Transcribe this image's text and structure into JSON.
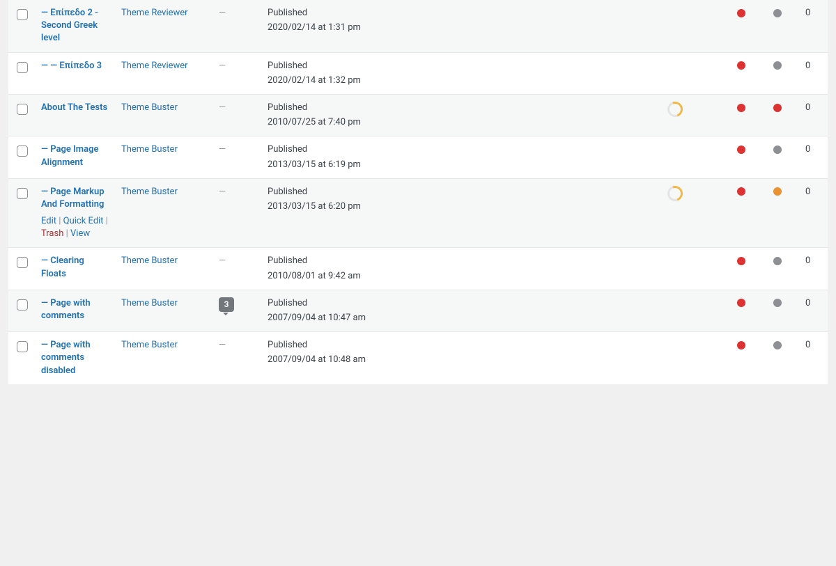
{
  "row_count": 8,
  "row_actions": {
    "edit": "Edit",
    "quick_edit": "Quick Edit",
    "trash": "Trash",
    "view": "View",
    "sep": " | "
  },
  "rows": [
    {
      "alt": true,
      "title": "— Επίπεδο 2 - Second Greek level",
      "author": "Theme Reviewer",
      "comments_dash": "—",
      "status": "Published",
      "datetime": "2020/02/14 at 1:31 pm",
      "readability_ring": false,
      "dot1": "red",
      "dot2": "grey",
      "links": "0",
      "show_actions": false
    },
    {
      "alt": false,
      "title": "— — Επίπεδο 3",
      "author": "Theme Reviewer",
      "comments_dash": "—",
      "status": "Published",
      "datetime": "2020/02/14 at 1:32 pm",
      "readability_ring": false,
      "dot1": "red",
      "dot2": "grey",
      "links": "0",
      "show_actions": false
    },
    {
      "alt": true,
      "title": "About The Tests",
      "author": "Theme Buster",
      "comments_dash": "—",
      "status": "Published",
      "datetime": "2010/07/25 at 7:40 pm",
      "readability_ring": true,
      "dot1": "red",
      "dot2": "red",
      "links": "0",
      "show_actions": false
    },
    {
      "alt": false,
      "title": "— Page Image Alignment",
      "author": "Theme Buster",
      "comments_dash": "—",
      "status": "Published",
      "datetime": "2013/03/15 at 6:19 pm",
      "readability_ring": false,
      "dot1": "red",
      "dot2": "grey",
      "links": "0",
      "show_actions": false
    },
    {
      "alt": true,
      "title": "— Page Markup And Formatting",
      "author": "Theme Buster",
      "comments_dash": "—",
      "status": "Published",
      "datetime": "2013/03/15 at 6:20 pm",
      "readability_ring": true,
      "dot1": "red",
      "dot2": "orange",
      "links": "0",
      "show_actions": true
    },
    {
      "alt": false,
      "title": "— Clearing Floats",
      "author": "Theme Buster",
      "comments_dash": "—",
      "status": "Published",
      "datetime": "2010/08/01 at 9:42 am",
      "readability_ring": false,
      "dot1": "red",
      "dot2": "grey",
      "links": "0",
      "show_actions": false
    },
    {
      "alt": true,
      "title": "— Page with comments",
      "author": "Theme Buster",
      "comments_count": "3",
      "status": "Published",
      "datetime": "2007/09/04 at 10:47 am",
      "readability_ring": false,
      "dot1": "red",
      "dot2": "grey",
      "links": "0",
      "show_actions": false
    },
    {
      "alt": false,
      "title": "— Page with comments disabled",
      "author": "Theme Buster",
      "comments_dash": "—",
      "status": "Published",
      "datetime": "2007/09/04 at 10:48 am",
      "readability_ring": false,
      "dot1": "red",
      "dot2": "grey",
      "links": "0",
      "show_actions": false
    }
  ]
}
